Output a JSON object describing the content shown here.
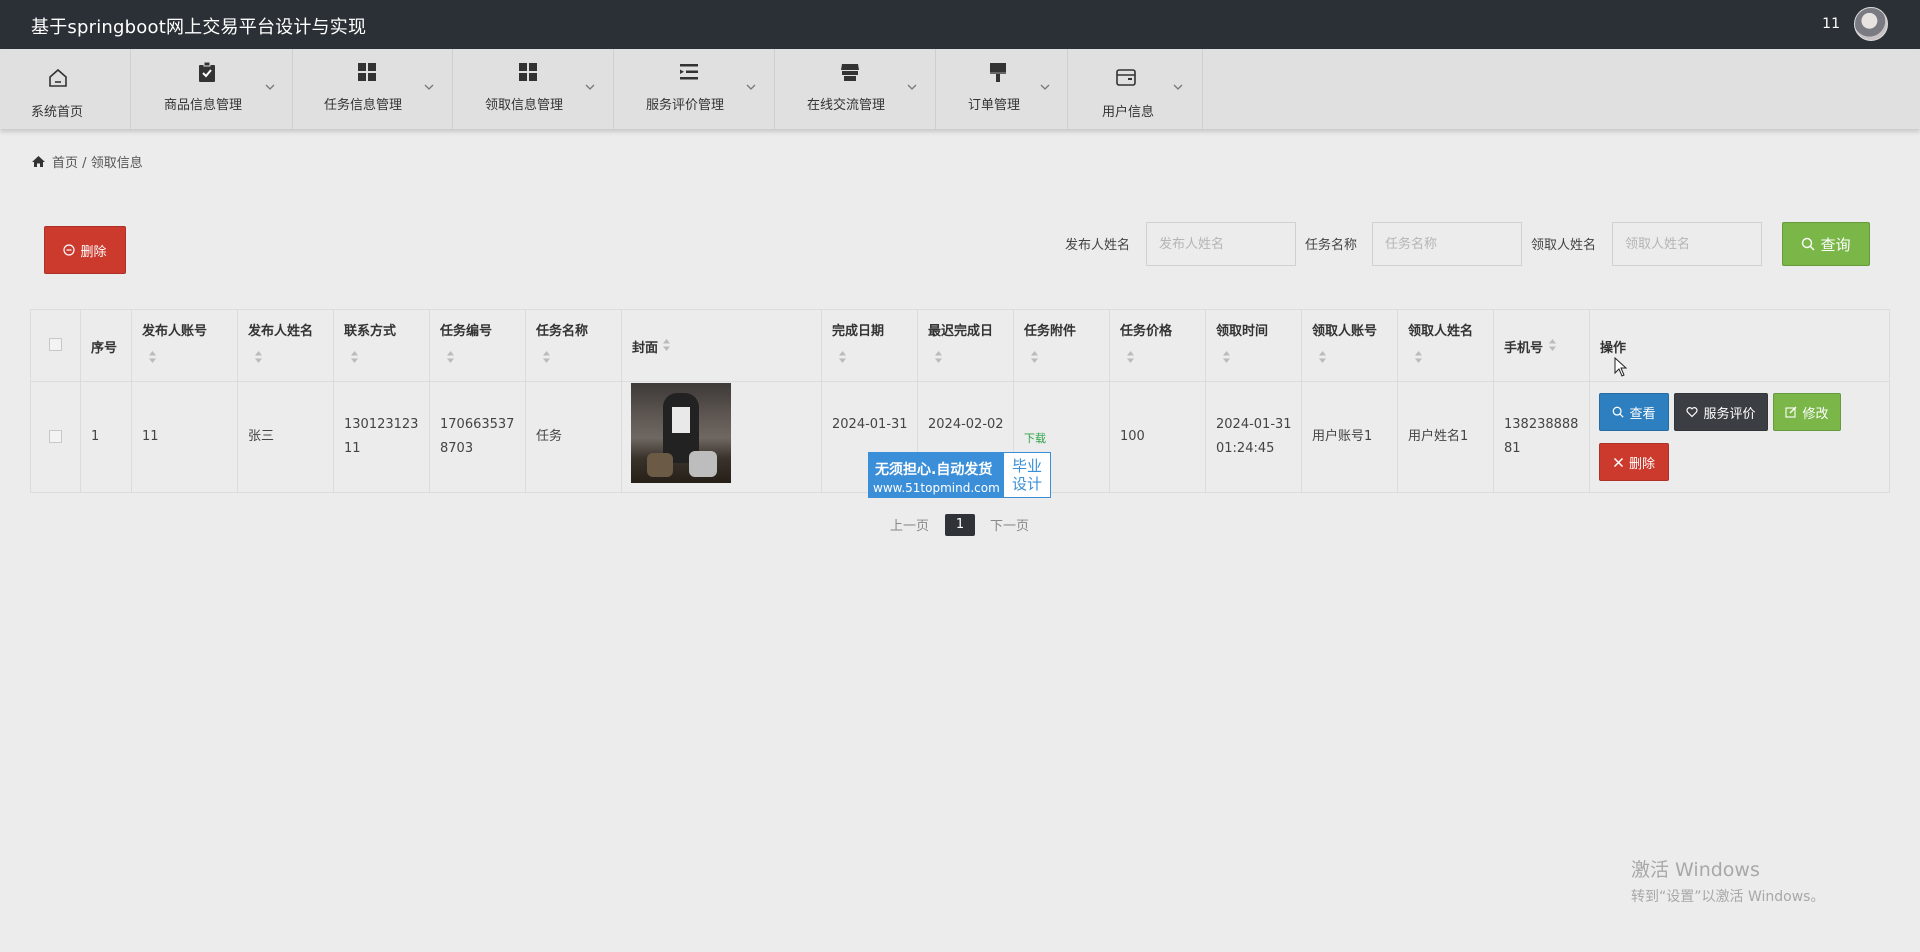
{
  "header": {
    "title": "基于springboot网上交易平台设计与实现",
    "user": "11"
  },
  "nav": [
    {
      "label": "系统首页",
      "icon": "home-icon"
    },
    {
      "label": "商品信息管理",
      "icon": "clipboard-check-icon"
    },
    {
      "label": "任务信息管理",
      "icon": "grid-icon"
    },
    {
      "label": "领取信息管理",
      "icon": "grid-icon"
    },
    {
      "label": "服务评价管理",
      "icon": "list-indent-icon"
    },
    {
      "label": "在线交流管理",
      "icon": "store-icon"
    },
    {
      "label": "订单管理",
      "icon": "brush-icon"
    },
    {
      "label": "用户信息",
      "icon": "wallet-icon"
    }
  ],
  "breadcrumb": {
    "home": "首页",
    "sep": "/",
    "current": "领取信息"
  },
  "toolbar": {
    "delete_label": "删除"
  },
  "filters": {
    "publisher_label": "发布人姓名",
    "publisher_placeholder": "发布人姓名",
    "task_label": "任务名称",
    "task_placeholder": "任务名称",
    "receiver_label": "领取人姓名",
    "receiver_placeholder": "领取人姓名",
    "search_label": "查询"
  },
  "table": {
    "headers": [
      "序号",
      "发布人账号",
      "发布人姓名",
      "联系方式",
      "任务编号",
      "任务名称",
      "封面",
      "完成日期",
      "最迟完成日",
      "任务附件",
      "任务价格",
      "领取时间",
      "领取人账号",
      "领取人姓名",
      "手机号",
      "操作"
    ],
    "row": {
      "index": "1",
      "publisher_account": "11",
      "publisher_name": "张三",
      "contact": "13012312311",
      "task_no": "1706635378703",
      "task_name": "任务",
      "finish_date": "2024-01-31",
      "deadline": "2024-02-02",
      "attachment": "下载",
      "price": "100",
      "receive_time": "2024-01-31 01:24:45",
      "receiver_account": "用户账号1",
      "receiver_name": "用户姓名1",
      "phone": "13823888881"
    },
    "actions": {
      "view": "查看",
      "review": "服务评价",
      "edit": "修改",
      "delete": "删除"
    }
  },
  "watermark": {
    "main": "无须担心.自动发货",
    "url": "www.51topmind.com",
    "tag1": "毕业",
    "tag2": "设计"
  },
  "pagination": {
    "prev": "上一页",
    "current": "1",
    "next": "下一页"
  },
  "windows": {
    "line1": "激活 Windows",
    "line2": "转到“设置”以激活 Windows。"
  },
  "colors": {
    "topbar": "#2a3035",
    "red": "#cc3a2e",
    "blue": "#2d7fbf",
    "dark": "#3b3f43",
    "green": "#7ab648"
  }
}
